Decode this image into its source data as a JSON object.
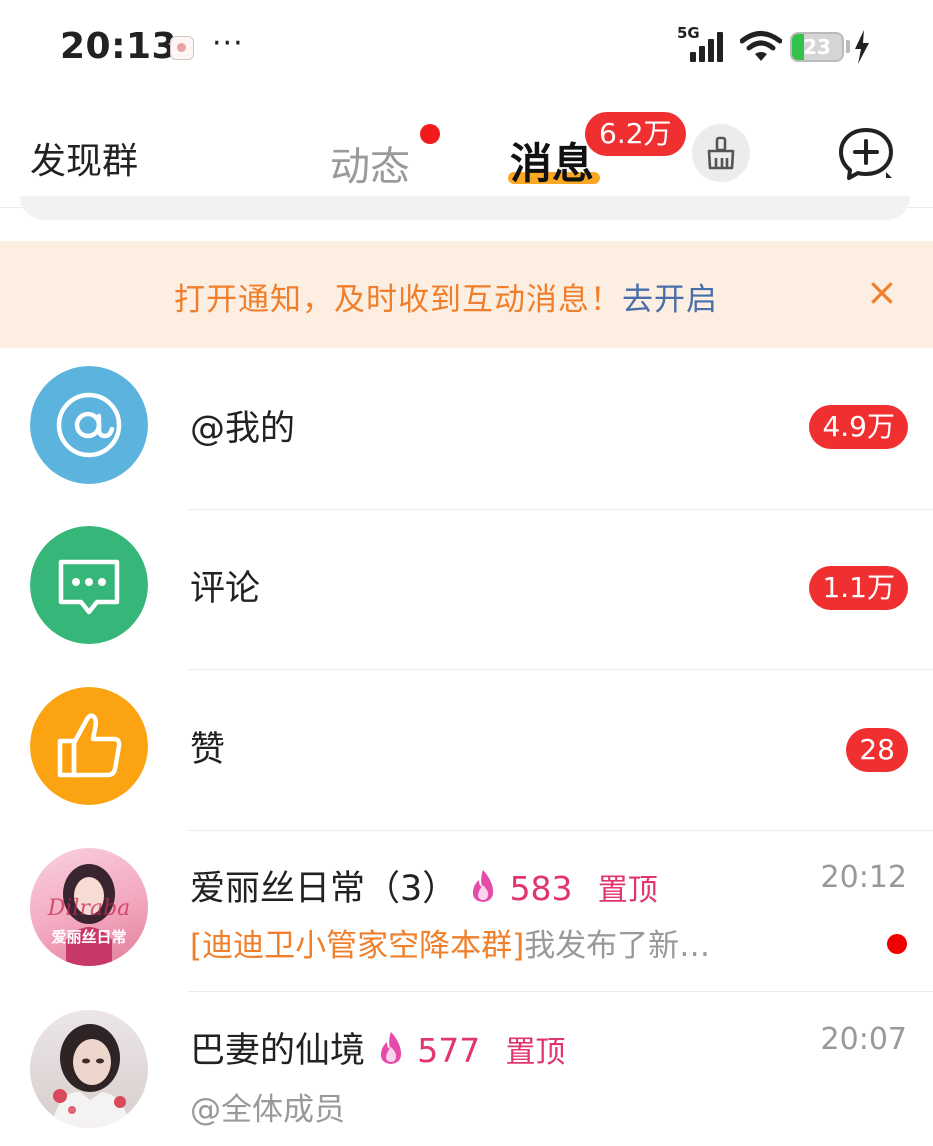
{
  "status_bar": {
    "time": "20:13",
    "more": "···",
    "network": "5G",
    "battery_level": "23",
    "battery_color": "#33c24a"
  },
  "header": {
    "discover_label": "发现群",
    "tab_feed_label": "动态",
    "tab_message_label": "消息",
    "tab_message_badge": "6.2万",
    "clean_icon": "broom-icon",
    "add_icon": "add-chat-icon",
    "accent_color": "#f9a825",
    "badge_color": "#f03030"
  },
  "notice": {
    "text": "打开通知，及时收到互动消息！",
    "link": "去开启",
    "close": "×"
  },
  "list": {
    "mentions": {
      "label": "@我的",
      "count": "4.9万",
      "icon": "at-icon",
      "color": "#5cb3de"
    },
    "comments": {
      "label": "评论",
      "count": "1.1万",
      "icon": "comment-icon",
      "color": "#36b779"
    },
    "likes": {
      "label": "赞",
      "count": "28",
      "icon": "thumbs-up-icon",
      "color": "#fca311"
    },
    "groups": [
      {
        "name": "爱丽丝日常（3）",
        "heat": "583",
        "pin": "置顶",
        "time": "20:12",
        "preview_highlight": "[迪迪卫小管家空降本群]",
        "preview_text": "我发布了新…",
        "avatar_caption": "爱丽丝日常",
        "avatar_script": "Dilraba",
        "unread": true
      },
      {
        "name": "巴妻的仙境",
        "heat": "577",
        "pin": "置顶",
        "time": "20:07",
        "preview_text": "@全体成员"
      }
    ]
  }
}
